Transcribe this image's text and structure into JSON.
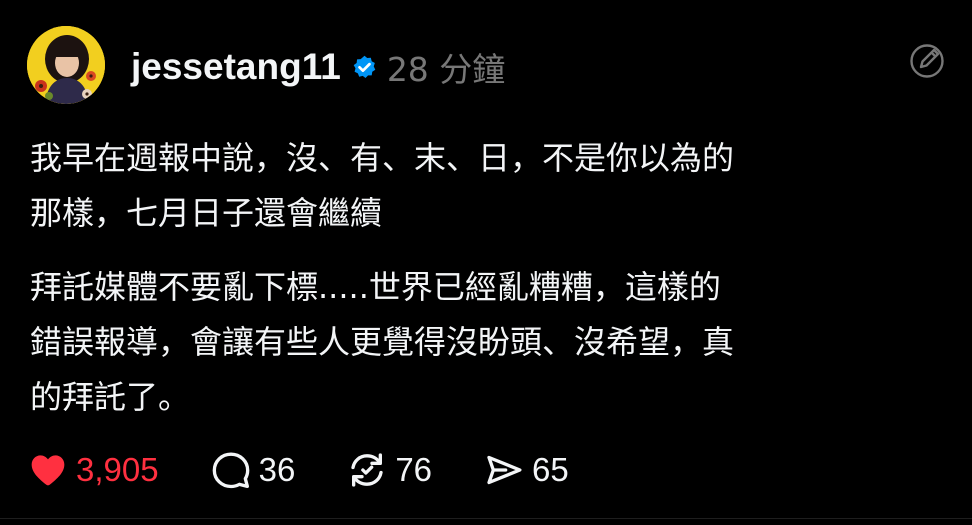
{
  "post": {
    "author": {
      "username": "jessetang11",
      "verified": true
    },
    "timestamp": "28 分鐘",
    "paragraphs": [
      {
        "lines": [
          "我早在週報中說，沒、有、末、日，不是你以為的",
          "那樣，七月日子還會繼續"
        ]
      },
      {
        "lines": [
          "拜託媒體不要亂下標.....世界已經亂糟糟，這樣的",
          "錯誤報導，會讓有些人更覺得沒盼頭、沒希望，真",
          "的拜託了。"
        ]
      }
    ],
    "actions": {
      "likes": "3,905",
      "comments": "36",
      "reposts": "76",
      "shares": "65"
    },
    "colors": {
      "background": "#000000",
      "text": "#f3f5f7",
      "muted": "#777777",
      "like": "#ff3040",
      "verified": "#0095f6"
    }
  }
}
